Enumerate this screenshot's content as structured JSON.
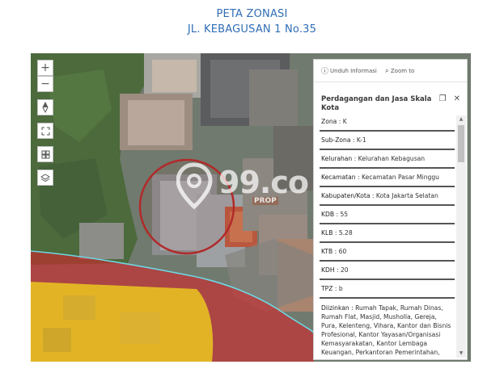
{
  "header": {
    "line1": "PETA ZONASI",
    "line2": "JL. KEBAGUSAN 1 No.35"
  },
  "map": {
    "controls": {
      "zoom_in": "+",
      "zoom_out": "−"
    },
    "watermark": {
      "text": "99.co",
      "sub": "PROP"
    },
    "colors": {
      "zone_red": "#d0262b",
      "zone_yellow": "#f1d41c",
      "boundary": "#6fd7e3",
      "circle": "#b12a2a"
    }
  },
  "panel": {
    "top_actions": {
      "download": "Unduh Informasi",
      "zoom": "Zoom to"
    },
    "title": "Perdagangan dan Jasa Skala Kota",
    "rows": [
      {
        "label": "Zona",
        "value": "K"
      },
      {
        "label": "Sub-Zona",
        "value": "K-1"
      },
      {
        "label": "Kelurahan",
        "value": "Kelurahan Kebagusan"
      },
      {
        "label": "Kecamatan",
        "value": "Kecamatan Pasar Minggu"
      },
      {
        "label": "Kabupaten/Kota",
        "value": "Kota Jakarta Selatan"
      },
      {
        "label": "KDB",
        "value": "55"
      },
      {
        "label": "KLB",
        "value": "5.28"
      },
      {
        "label": "KTB",
        "value": "60"
      },
      {
        "label": "KDH",
        "value": "20"
      },
      {
        "label": "TPZ",
        "value": "b"
      }
    ],
    "diizinkan": {
      "label": "Diizinkan",
      "value": "Rumah Tapak, Rumah Dinas, Rumah Flat, Masjid, Musholla, Gereja, Pura, Kelenteng, Vihara, Kantor dan Bisnis Profesional, Kantor Yayasan/Organisasi Kemasyarakatan, Kantor Lembaga Keuangan, Perkantoran Pemerintahan, Perkantoran"
    }
  }
}
